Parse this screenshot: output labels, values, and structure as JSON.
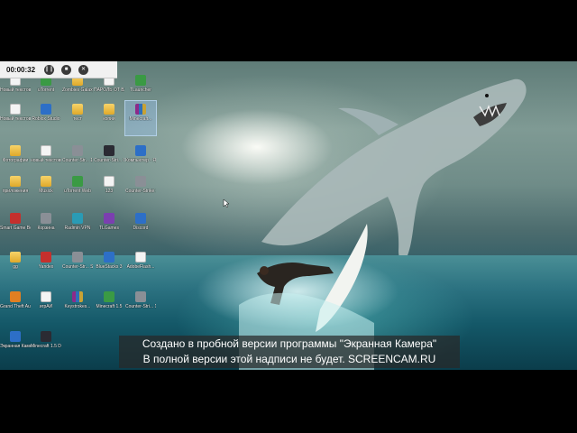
{
  "recorder": {
    "time": "00:00:32",
    "pause_icon": "pause-icon",
    "stop_icon": "stop-icon",
    "close_icon": "close-icon"
  },
  "desktop_icons": [
    {
      "label": "Новый текстово...",
      "kind": "doc"
    },
    {
      "label": "uTorrent",
      "kind": "app-green"
    },
    {
      "label": "Zombies Galaxy",
      "kind": "folder"
    },
    {
      "label": "ПАРОЛЬ ОТ ВАЙФАЙ",
      "kind": "doc"
    },
    {
      "label": "TLauncher",
      "kind": "app-green"
    },
    {
      "label": "Новый текстово...",
      "kind": "doc"
    },
    {
      "label": "Roblox Studio",
      "kind": "app-blue"
    },
    {
      "label": "тест",
      "kind": "folder"
    },
    {
      "label": "копии",
      "kind": "folder"
    },
    {
      "label": "Minecraft...",
      "kind": "app-rar"
    },
    {
      "label": "Фотографии",
      "kind": "folder"
    },
    {
      "label": "новый текстовый...",
      "kind": "doc"
    },
    {
      "label": "Counter-Str... 1.6",
      "kind": "app-gray"
    },
    {
      "label": "Counter-Stri... Global Offe...",
      "kind": "app-dark"
    },
    {
      "label": "Компьютер - Ярлык",
      "kind": "app-blue"
    },
    {
      "label": "приложения",
      "kind": "folder"
    },
    {
      "label": "Musick",
      "kind": "folder"
    },
    {
      "label": "uTorrent Web",
      "kind": "app-green"
    },
    {
      "label": "123",
      "kind": "doc"
    },
    {
      "label": "Counter-Strike 1.6",
      "kind": "app-gray"
    },
    {
      "label": "Smart Game Booster",
      "kind": "app-red"
    },
    {
      "label": "Корзина",
      "kind": "app-gray"
    },
    {
      "label": "Radmin VPN",
      "kind": "app-teal"
    },
    {
      "label": "TLGames",
      "kind": "app-purple"
    },
    {
      "label": "Discord",
      "kind": "app-blue"
    },
    {
      "label": "gg",
      "kind": "folder"
    },
    {
      "label": "Yandex",
      "kind": "app-red"
    },
    {
      "label": "Counter-Str... Source RXF",
      "kind": "app-gray"
    },
    {
      "label": "BlueStacks 3",
      "kind": "app-blue"
    },
    {
      "label": "AdobeFlash...",
      "kind": "doc"
    },
    {
      "label": "Grand Theft Auto - Sa...",
      "kind": "app-orange"
    },
    {
      "label": "игрАЙ",
      "kind": "doc"
    },
    {
      "label": "Keystrokes...",
      "kind": "app-rar"
    },
    {
      "label": "Minecraft 1.5",
      "kind": "app-green"
    },
    {
      "label": "Counter-Stri... 1.6 by Milky",
      "kind": "app-gray"
    },
    {
      "label": "Экранная Камера",
      "kind": "app-blue"
    },
    {
      "label": "Minecraft 1.5 Desktop",
      "kind": "app-dark"
    }
  ],
  "watermark": {
    "line1": "Создано в пробной версии программы \"Экранная Камера\"",
    "line2": "В полной версии этой надписи не будет. SCREENCAM.RU"
  }
}
